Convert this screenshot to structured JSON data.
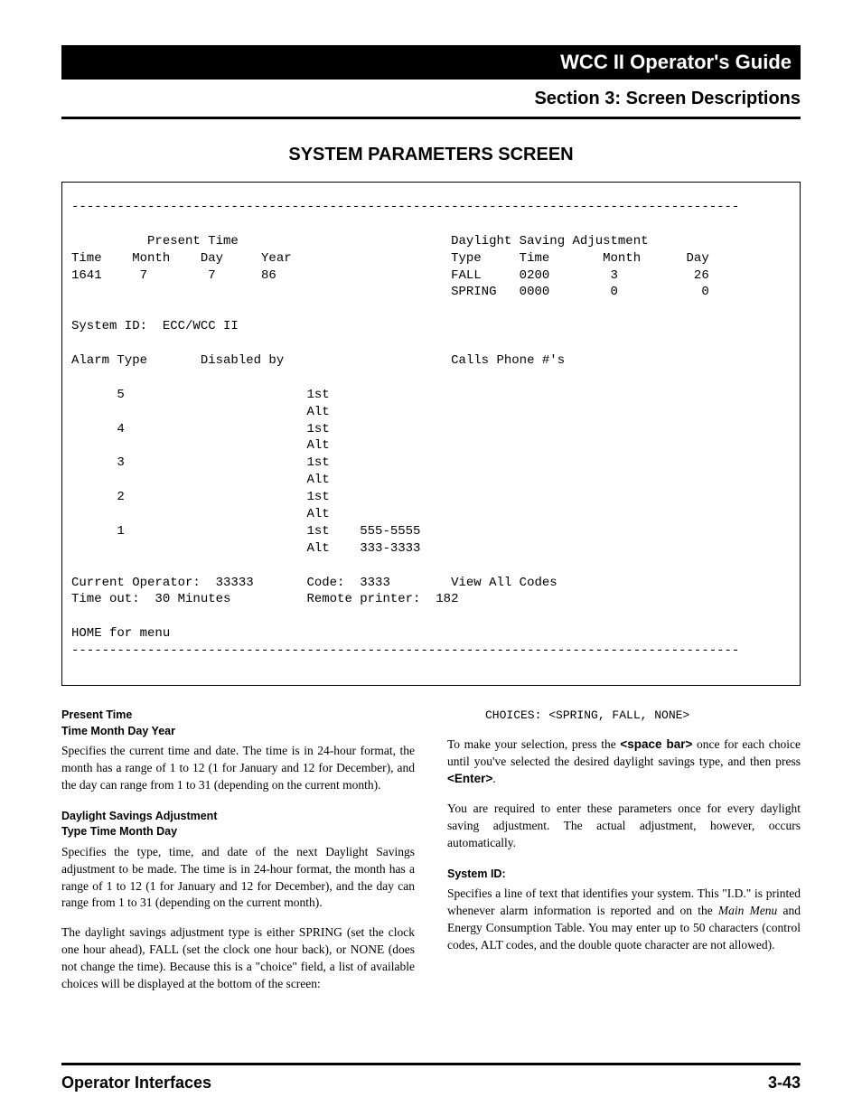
{
  "header": {
    "guide_title": "WCC II Operator's Guide",
    "section_title": "Section 3:  Screen Descriptions",
    "page_title": "SYSTEM PARAMETERS SCREEN"
  },
  "terminal": "----------------------------------------------------------------------------------------\n\n          Present Time                            Daylight Saving Adjustment\nTime    Month    Day     Year                     Type     Time       Month      Day\n1641     7        7      86                       FALL     0200        3          26\n                                                  SPRING   0000        0           0\n\nSystem ID:  ECC/WCC II\n\nAlarm Type       Disabled by                      Calls Phone #'s\n\n      5                        1st\n                               Alt\n      4                        1st\n                               Alt\n      3                        1st\n                               Alt\n      2                        1st\n                               Alt\n      1                        1st    555-5555\n                               Alt    333-3333\n\nCurrent Operator:  33333       Code:  3333        View All Codes\nTime out:  30 Minutes          Remote printer:  182\n\nHOME for menu\n----------------------------------------------------------------------------------------",
  "left_col": {
    "label1_line1": "Present Time",
    "label1_line2": "Time  Month  Day  Year",
    "para1": "Specifies the current time and date. The time is in 24-hour format, the month has a range of 1 to 12 (1 for January and 12 for December), and the day can range from 1 to 31 (depending on the current month).",
    "label2_line1": "Daylight  Savings  Adjustment",
    "label2_line2": "Type  Time  Month  Day",
    "para2": "Specifies the type, time, and date of the next Daylight Savings adjustment to be made. The time is in 24-hour format, the month has a range of 1 to 12 (1 for January and 12 for December), and the day can range from 1 to 31 (depending on the current month).",
    "para3": "The daylight savings adjustment type is either SPRING (set the clock one hour ahead), FALL (set the clock one hour back), or NONE (does not change the time). Because this is a \"choice\" field, a list of available choices will be displayed at the bottom of the screen:"
  },
  "right_col": {
    "choices": "CHOICES:  <SPRING, FALL, NONE>",
    "para1_a": "To make your selection, press the ",
    "para1_b": "<space bar>",
    "para1_c": " once for each choice until you've selected the desired daylight savings type, and then press ",
    "para1_d": "<Enter>",
    "para1_e": ".",
    "para2": "You are required to enter these parameters once for every daylight saving adjustment. The actual adjustment, however, occurs automatically.",
    "label3": "System ID:",
    "para3_a": "Specifies a line of text that identifies your system. This \"I.D.\" is printed whenever alarm information is reported and on the ",
    "para3_b": "Main Menu",
    "para3_c": " and Energy Consumption Table. You may enter up to 50 characters (control codes, ALT codes, and the double quote character are not allowed)."
  },
  "footer": {
    "left": "Operator Interfaces",
    "right": "3-43"
  }
}
